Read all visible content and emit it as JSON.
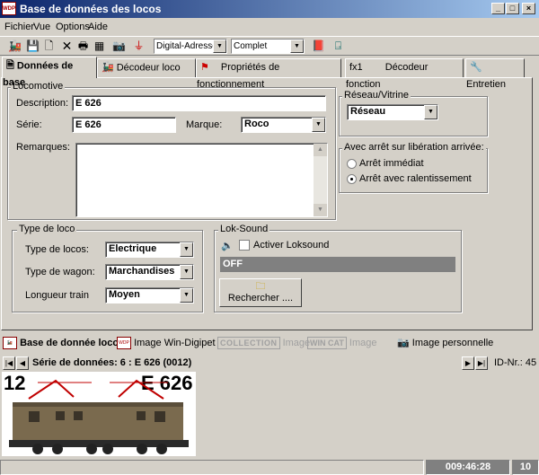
{
  "window": {
    "title": "Base de données des locos",
    "app_icon_text": "WDP"
  },
  "menu": [
    "Fichier",
    "Vue",
    "Options",
    "Aide"
  ],
  "toolbar": {
    "address_mode": "Digital-Adresse",
    "view_mode": "Complet"
  },
  "tabs": [
    {
      "label": "Données de base",
      "icon": "document-icon"
    },
    {
      "label": "Décodeur loco",
      "icon": "locomotive-decoder-icon"
    },
    {
      "label": "Propriétés de fonctionnement",
      "icon": "flag-icon"
    },
    {
      "label": "Décodeur fonction",
      "icon": "function-decoder-icon",
      "prefix": "fx1"
    },
    {
      "label": "Entretien",
      "icon": "wrench-icon"
    }
  ],
  "locomotive": {
    "group_label": "Locomotive",
    "description_label": "Description:",
    "description_value": "E 626",
    "serie_label": "Série:",
    "serie_value": "E 626",
    "marque_label": "Marque:",
    "marque_value": "Roco",
    "remarques_label": "Remarques:",
    "remarques_value": ""
  },
  "reseau": {
    "group_label": "Réseau/Vitrine",
    "value": "Réseau"
  },
  "arret": {
    "group_label": "Avec arrêt sur libération arrivée:",
    "options": [
      "Arrêt immédiat",
      "Arrêt avec ralentissement"
    ],
    "selected": 1
  },
  "type_loco": {
    "group_label": "Type de loco",
    "type_label": "Type de locos:",
    "type_value": "Electrique",
    "wagon_label": "Type de wagon:",
    "wagon_value": "Marchandises",
    "longueur_label": "Longueur train",
    "longueur_value": "Moyen"
  },
  "loksound": {
    "group_label": "Lok-Sound",
    "activate_label": "Activer Loksound",
    "activated": false,
    "status": "OFF",
    "search_button": "Rechercher ...."
  },
  "bottom_tabs": [
    {
      "label": "Base de donnée locos",
      "active": true
    },
    {
      "label": "Image Win-Digipet",
      "active": false
    },
    {
      "label": "Image",
      "logo": "COLLECTION",
      "active": false
    },
    {
      "label": "Image",
      "logo": "WIN CAT",
      "active": false
    },
    {
      "label": "Image personnelle",
      "active": false
    }
  ],
  "navigator": {
    "record_text": "Série de données: 6 : E 626  (0012)",
    "id_text": "ID-Nr.: 45"
  },
  "image": {
    "number": "12",
    "name": "E 626"
  },
  "statusbar": {
    "time": "009:46:28",
    "count": "10"
  },
  "colors": {
    "title_start": "#0a246a",
    "title_end": "#a6caf0",
    "face": "#d4d0c8",
    "loksound_bar": "#808080"
  }
}
